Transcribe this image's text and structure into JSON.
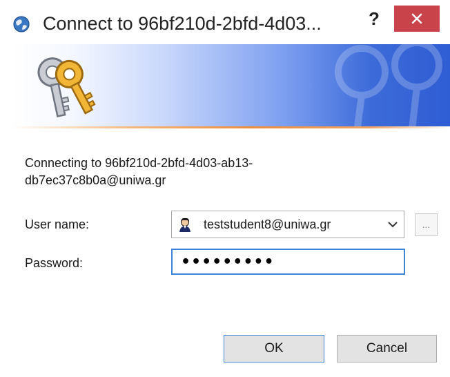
{
  "window": {
    "title": "Connect to 96bf210d-2bfd-4d03...",
    "help_label": "?",
    "close_label": "×"
  },
  "colors": {
    "close_button": "#c9434a",
    "banner_dark": "#2f5dd3",
    "accent_line": "#ee8d3a",
    "focus_border": "#3c84d8"
  },
  "message": "Connecting to 96bf210d-2bfd-4d03-ab13-db7ec37c8b0a@uniwa.gr",
  "form": {
    "username_label": "User name:",
    "username_value": "teststudent8@uniwa.gr",
    "browse_label": "...",
    "password_label": "Password:",
    "password_value": "•••••••••"
  },
  "buttons": {
    "ok": "OK",
    "cancel": "Cancel"
  },
  "icons": {
    "app": "globe-icon",
    "banner": "keys-icon",
    "user": "user-avatar-icon",
    "dropdown": "chevron-down-icon"
  }
}
